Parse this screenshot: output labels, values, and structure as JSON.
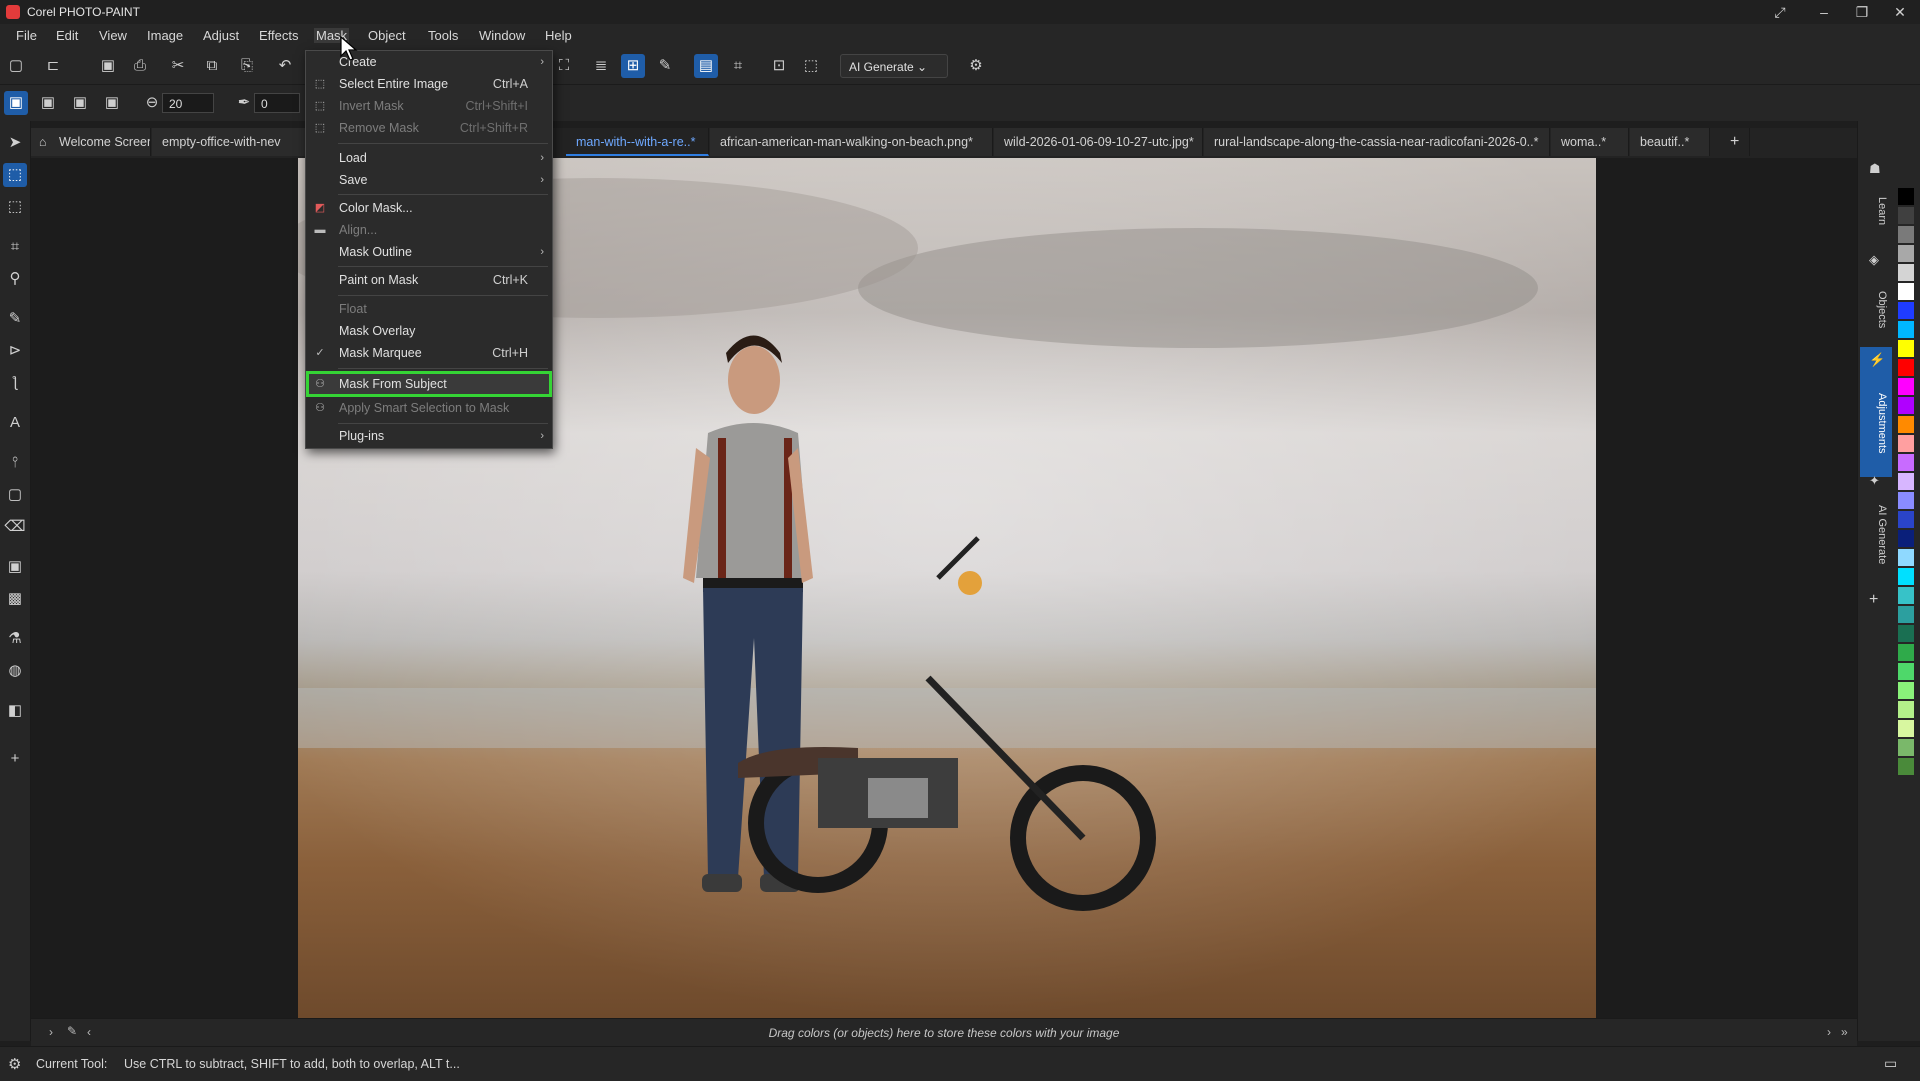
{
  "window": {
    "title": "Corel PHOTO-PAINT",
    "min": "–",
    "restore": "❐",
    "close": "✕",
    "extra": "⤢"
  },
  "menubar": [
    "File",
    "Edit",
    "View",
    "Image",
    "Adjust",
    "Effects",
    "Mask",
    "Object",
    "Tools",
    "Window",
    "Help"
  ],
  "toolbar": {
    "brush_size": "20",
    "brush_val": "0",
    "ai_generate": "AI Generate"
  },
  "tabs": [
    "Welcome Screen",
    "empty-office-with-nev",
    "man-with--with-a-re..*",
    "african-american-man-walking-on-beach.png*",
    "wild-2026-01-06-09-10-27-utc.jpg*",
    "rural-landscape-along-the-cassia-near-radicofani-2026-0..*",
    "woma..*",
    "beautif..*"
  ],
  "tab_add": "+",
  "mask_menu": [
    {
      "label": "Create",
      "submenu": true
    },
    {
      "label": "Select Entire Image",
      "shortcut": "Ctrl+A"
    },
    {
      "label": "Invert Mask",
      "shortcut": "Ctrl+Shift+I",
      "disabled": true
    },
    {
      "label": "Remove Mask",
      "shortcut": "Ctrl+Shift+R",
      "disabled": true
    },
    {
      "label": "Load",
      "submenu": true
    },
    {
      "label": "Save",
      "submenu": true
    },
    {
      "label": "Color Mask..."
    },
    {
      "label": "Align...",
      "disabled": true
    },
    {
      "label": "Mask Outline",
      "submenu": true
    },
    {
      "label": "Paint on Mask",
      "shortcut": "Ctrl+K"
    },
    {
      "label": "Float",
      "disabled": true
    },
    {
      "label": "Mask Overlay"
    },
    {
      "label": "Mask Marquee",
      "shortcut": "Ctrl+H",
      "checked": true
    },
    {
      "label": "Mask From Subject",
      "highlighted": true
    },
    {
      "label": "Apply Smart Selection to Mask",
      "disabled": true
    },
    {
      "label": "Plug-ins",
      "submenu": true
    }
  ],
  "palette_hint": "Drag colors (or objects) here to store these colors with your image",
  "status": {
    "current_tool_label": "Current Tool:",
    "hint": "Use CTRL to subtract, SHIFT to add, both to overlap, ALT t..."
  },
  "docker_tabs": [
    "Learn",
    "Objects",
    "Adjustments",
    "AI Generate"
  ],
  "colors": {
    "accent": "#1f5da8",
    "highlight_outline": "#35d435",
    "active_tab": "#6ea8ff"
  },
  "swatches": [
    "#000000",
    "#404040",
    "#7a7a7a",
    "#a8a8a8",
    "#d4d4d4",
    "#ffffff",
    "#1f3cff",
    "#00b7ff",
    "#ffff00",
    "#ff0000",
    "#ff00ff",
    "#b000ff",
    "#ff8a00",
    "#ff9fa0",
    "#c86bff",
    "#d7b6ff",
    "#8a8cff",
    "#2a44c8",
    "#0a1f7a",
    "#8fd9ff",
    "#00e0ff",
    "#37c2c8",
    "#2c9f9f",
    "#1a6f52",
    "#2faa4a",
    "#4ed86a",
    "#8af27a",
    "#b3f08a",
    "#d8f7a0",
    "#7ab86a",
    "#4a8a3a"
  ]
}
